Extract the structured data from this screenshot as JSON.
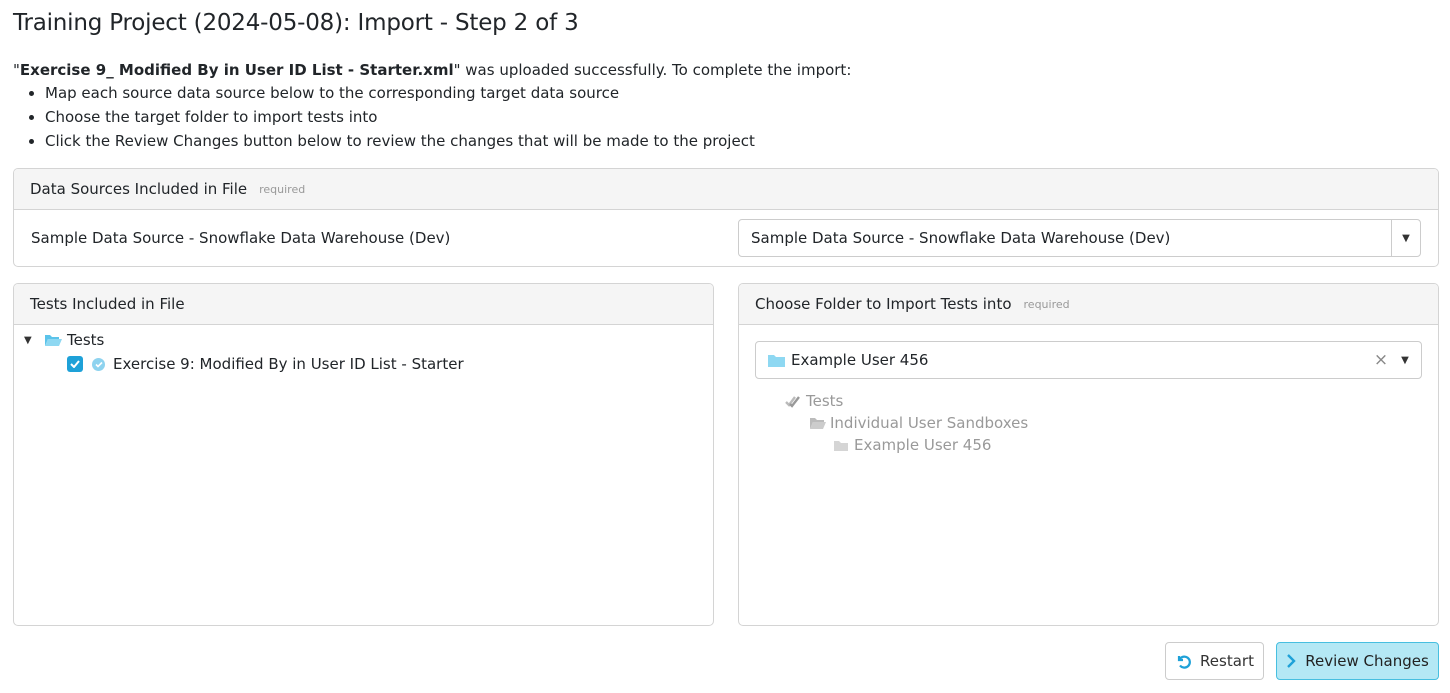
{
  "page": {
    "title": "Training Project (2024-05-08): Import - Step 2 of 3"
  },
  "intro": {
    "quote_open": "\"",
    "filename": "Exercise 9_ Modified By in User ID List - Starter.xml",
    "message": "\" was uploaded successfully. To complete the import:",
    "steps": [
      "Map each source data source below to the corresponding target data source",
      "Choose the target folder to import tests into",
      "Click the Review Changes button below to review the changes that will be made to the project"
    ]
  },
  "data_sources": {
    "header": "Data Sources Included in File",
    "required_label": "required",
    "rows": [
      {
        "source": "Sample Data Source - Snowflake Data Warehouse (Dev)",
        "target": "Sample Data Source - Snowflake Data Warehouse (Dev)"
      }
    ]
  },
  "tests_panel": {
    "header": "Tests Included in File",
    "root": {
      "label": "Tests",
      "icon": "folder-open-icon",
      "expanded": true
    },
    "items": [
      {
        "label": "Exercise 9: Modified By in User ID List - Starter",
        "checked": true,
        "icon": "check-circle-icon"
      }
    ]
  },
  "folder_panel": {
    "header": "Choose Folder to Import Tests into",
    "required_label": "required",
    "selected": "Example User 456",
    "tree": [
      {
        "label": "Tests",
        "icon": "double-check-icon",
        "level": 0
      },
      {
        "label": "Individual User Sandboxes",
        "icon": "folder-open-icon",
        "level": 1
      },
      {
        "label": "Example User 456",
        "icon": "folder-icon",
        "level": 2
      }
    ]
  },
  "actions": {
    "restart_label": "Restart",
    "review_label": "Review Changes"
  },
  "colors": {
    "accent": "#1ea1d8",
    "primary_button_bg": "#b4e8f5",
    "primary_button_border": "#47bfe0",
    "panel_header_bg": "#f5f5f5"
  }
}
